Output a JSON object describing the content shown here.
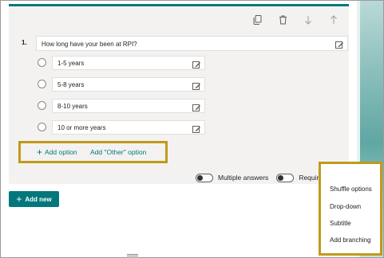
{
  "question": {
    "number": "1.",
    "text": "How long have your been at RPI?"
  },
  "options": [
    {
      "label": "1-5 years"
    },
    {
      "label": "5-8 years"
    },
    {
      "label": "8-10 years"
    },
    {
      "label": "10 or more years"
    }
  ],
  "add_actions": {
    "add_option": "Add option",
    "add_other": "Add \"Other\" option"
  },
  "settings": {
    "multiple_answers": "Multiple answers",
    "required": "Required",
    "more": "···"
  },
  "add_new": "Add new",
  "menu": {
    "items": [
      "Shuffle options",
      "Drop-down",
      "Subtitle",
      "Add branching"
    ]
  },
  "toolbar_icons": [
    "copy-icon",
    "delete-icon",
    "move-down-icon",
    "move-up-icon"
  ],
  "colors": {
    "accent": "#03787c",
    "highlight_border": "#c19a1a",
    "card_bg": "#f3f2f1"
  }
}
